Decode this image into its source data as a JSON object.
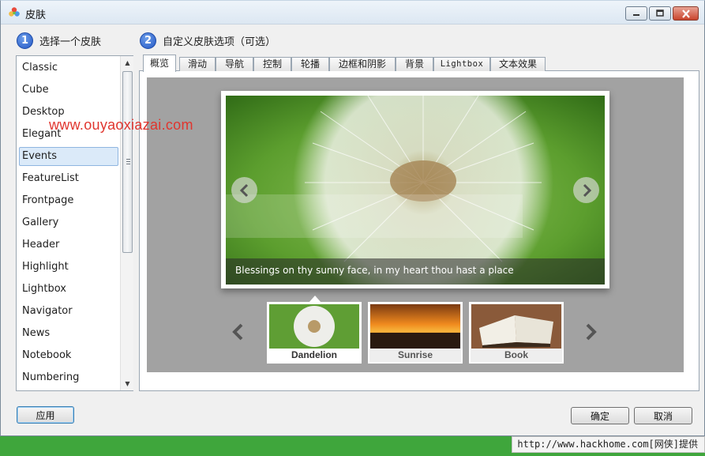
{
  "window": {
    "title": "皮肤",
    "controls": {
      "minimize": "minimize-icon",
      "maximize": "maximize-icon",
      "close": "close-icon"
    }
  },
  "steps": [
    {
      "number": "1",
      "label": "选择一个皮肤"
    },
    {
      "number": "2",
      "label": "自定义皮肤选项（可选）"
    }
  ],
  "skins": {
    "selected": "Events",
    "items": [
      "Classic",
      "Cube",
      "Desktop",
      "Elegant",
      "Events",
      "FeatureList",
      "Frontpage",
      "Gallery",
      "Header",
      "Highlight",
      "Lightbox",
      "Navigator",
      "News",
      "Notebook",
      "Numbering"
    ]
  },
  "tabs": {
    "active": "概览",
    "items": [
      "概览",
      "滑动",
      "导航",
      "控制",
      "轮播",
      "边框和阴影",
      "背景",
      "Lightbox",
      "文本效果"
    ]
  },
  "preview": {
    "watermark": "www.ouyaoxiazai.com",
    "caption": "Blessings on thy sunny face, in my heart thou hast a place",
    "thumbnails": [
      {
        "label": "Dandelion",
        "active": true
      },
      {
        "label": "Sunrise",
        "active": false
      },
      {
        "label": "Book",
        "active": false
      }
    ]
  },
  "buttons": {
    "apply": "应用",
    "ok": "确定",
    "cancel": "取消"
  },
  "footer": {
    "credit": "http://www.hackhome.com[网侠]提供"
  },
  "colors": {
    "selection_bg": "#dbeaf9",
    "preview_bg": "#a2a2a2",
    "footer_green": "#3fa63c",
    "step_badge": "#2256c4"
  }
}
